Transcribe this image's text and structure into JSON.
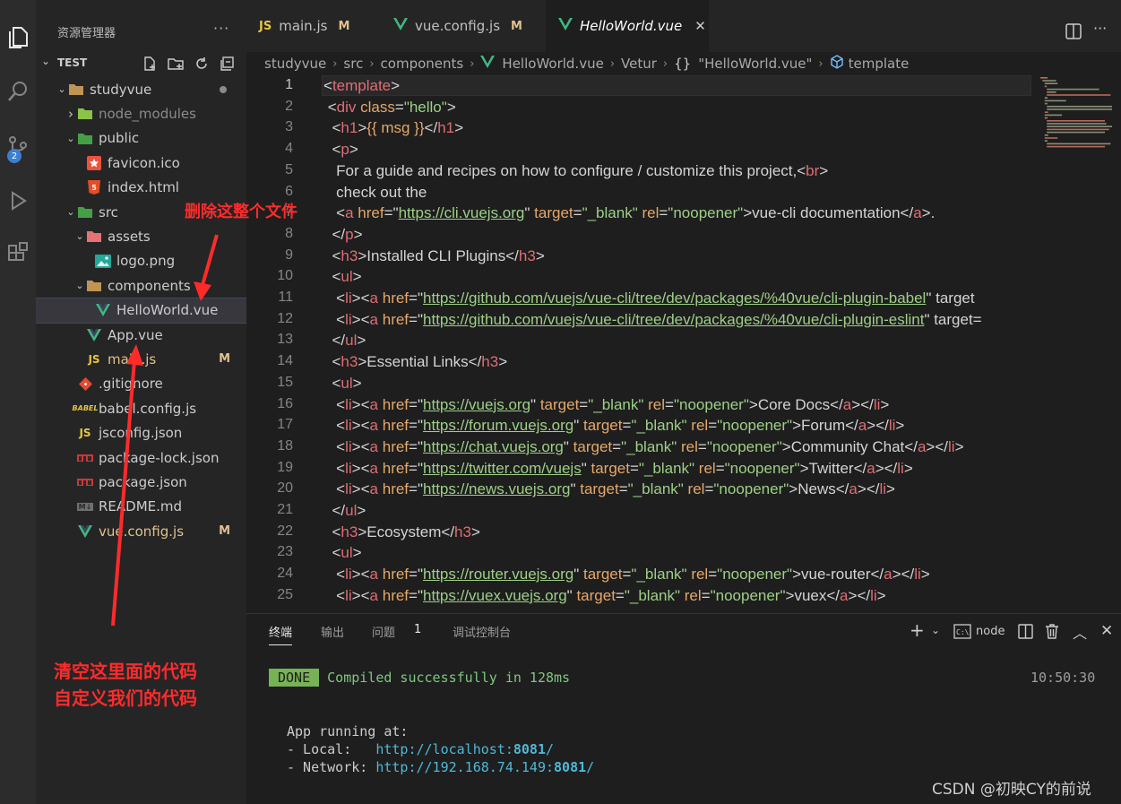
{
  "activity_bar": {
    "items": [
      {
        "name": "explorer",
        "icon": "files-icon"
      },
      {
        "name": "search",
        "icon": "search-icon"
      },
      {
        "name": "source-control",
        "icon": "source-control-icon",
        "badge": "2"
      },
      {
        "name": "run-debug",
        "icon": "run-debug-icon"
      },
      {
        "name": "extensions",
        "icon": "extensions-icon"
      }
    ]
  },
  "sidebar": {
    "title": "资源管理器",
    "more": "···",
    "section": "TEST",
    "tree": [
      {
        "name": "studyvue",
        "depth": 0,
        "kind": "folder",
        "open": true,
        "status": "dot"
      },
      {
        "name": "node_modules",
        "depth": 1,
        "kind": "folder",
        "open": false,
        "dim": true
      },
      {
        "name": "public",
        "depth": 1,
        "kind": "folder",
        "open": true
      },
      {
        "name": "favicon.ico",
        "depth": 2,
        "kind": "favicon"
      },
      {
        "name": "index.html",
        "depth": 2,
        "kind": "html"
      },
      {
        "name": "src",
        "depth": 1,
        "kind": "folder",
        "open": true
      },
      {
        "name": "assets",
        "depth": 2,
        "kind": "folder",
        "open": true
      },
      {
        "name": "logo.png",
        "depth": 3,
        "kind": "image"
      },
      {
        "name": "components",
        "depth": 2,
        "kind": "folder",
        "open": true
      },
      {
        "name": "HelloWorld.vue",
        "depth": 3,
        "kind": "vue",
        "selected": true
      },
      {
        "name": "App.vue",
        "depth": 2,
        "kind": "vue"
      },
      {
        "name": "main.js",
        "depth": 2,
        "kind": "js",
        "status": "M"
      },
      {
        "name": ".gitignore",
        "depth": 1,
        "kind": "git"
      },
      {
        "name": "babel.config.js",
        "depth": 1,
        "kind": "babel"
      },
      {
        "name": "jsconfig.json",
        "depth": 1,
        "kind": "jsconfig"
      },
      {
        "name": "package-lock.json",
        "depth": 1,
        "kind": "npm"
      },
      {
        "name": "package.json",
        "depth": 1,
        "kind": "npm"
      },
      {
        "name": "README.md",
        "depth": 1,
        "kind": "md"
      },
      {
        "name": "vue.config.js",
        "depth": 1,
        "kind": "vue",
        "status": "M"
      }
    ]
  },
  "tabs": [
    {
      "label": "main.js",
      "icon": "JS",
      "status": "M"
    },
    {
      "label": "vue.config.js",
      "icon": "V",
      "status": "M"
    },
    {
      "label": "HelloWorld.vue",
      "icon": "V",
      "close": "✕",
      "active": true
    }
  ],
  "breadcrumb": [
    "studyvue",
    "src",
    "components",
    "HelloWorld.vue",
    "Vetur",
    "\"HelloWorld.vue\"",
    "template"
  ],
  "editor": {
    "line_numbers": [
      "1",
      "2",
      "3",
      "4",
      "5",
      "6",
      "7",
      "8",
      "9",
      "10",
      "11",
      "12",
      "13",
      "14",
      "15",
      "16",
      "17",
      "18",
      "19",
      "20",
      "21",
      "22",
      "23",
      "24",
      "25"
    ],
    "code_lines": [
      "<template>",
      "  <div class=\"hello\">",
      "    <h1>{{ msg }}</h1>",
      "    <p>",
      "      For a guide and recipes on how to configure / customize this project,<br>",
      "      check out the",
      "      <a href=\"https://cli.vuejs.org\" target=\"_blank\" rel=\"noopener\">vue-cli documentation</a>.",
      "    </p>",
      "    <h3>Installed CLI Plugins</h3>",
      "    <ul>",
      "      <li><a href=\"https://github.com/vuejs/vue-cli/tree/dev/packages/%40vue/cli-plugin-babel\" target",
      "      <li><a href=\"https://github.com/vuejs/vue-cli/tree/dev/packages/%40vue/cli-plugin-eslint\" target=",
      "    </ul>",
      "    <h3>Essential Links</h3>",
      "    <ul>",
      "      <li><a href=\"https://vuejs.org\" target=\"_blank\" rel=\"noopener\">Core Docs</a></li>",
      "      <li><a href=\"https://forum.vuejs.org\" target=\"_blank\" rel=\"noopener\">Forum</a></li>",
      "      <li><a href=\"https://chat.vuejs.org\" target=\"_blank\" rel=\"noopener\">Community Chat</a></li>",
      "      <li><a href=\"https://twitter.com/vuejs\" target=\"_blank\" rel=\"noopener\">Twitter</a></li>",
      "      <li><a href=\"https://news.vuejs.org\" target=\"_blank\" rel=\"noopener\">News</a></li>",
      "    </ul>",
      "    <h3>Ecosystem</h3>",
      "    <ul>",
      "      <li><a href=\"https://router.vuejs.org\" target=\"_blank\" rel=\"noopener\">vue-router</a></li>",
      "      <li><a href=\"https://vuex.vuejs.org\" target=\"_blank\" rel=\"noopener\">vuex</a></li>"
    ]
  },
  "panel": {
    "tabs": [
      "终端",
      "输出",
      "问题",
      "调试控制台"
    ],
    "problems_count": "1",
    "terminal_name": "node",
    "done_badge": "DONE",
    "compiled": "Compiled successfully in 128ms",
    "time": "10:50:30",
    "app_running": "App running at:",
    "local_label": "- Local:   ",
    "local_url_prefix": "http://localhost:",
    "local_port": "8081",
    "local_suffix": "/",
    "network_label": "- Network: ",
    "network_url_prefix": "http://192.168.74.149:",
    "network_port": "8081",
    "network_suffix": "/"
  },
  "annotations": {
    "delete_file": "删除这整个文件",
    "clear_code_1": "清空这里面的代码",
    "clear_code_2": "自定义我们的代码",
    "color": "#ff2b2b"
  },
  "watermark": "CSDN @初映CY的前说"
}
